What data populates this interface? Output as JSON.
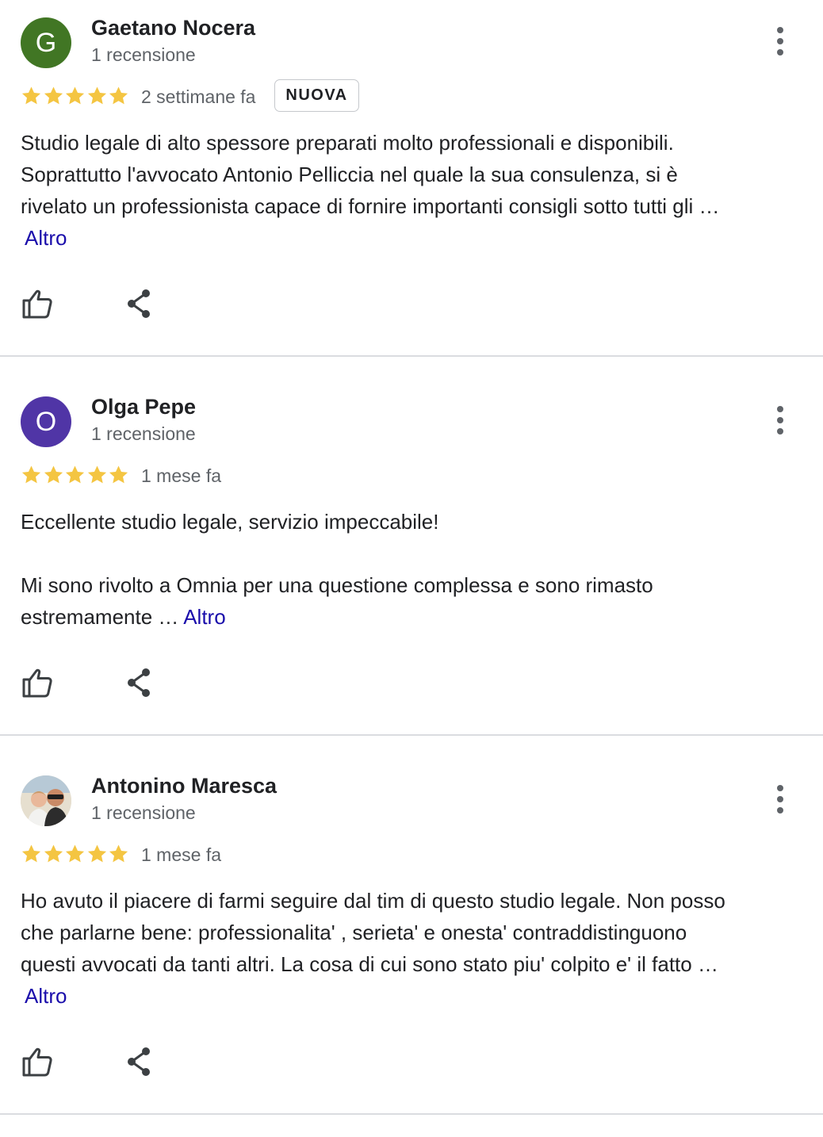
{
  "reviews": [
    {
      "avatar_letter": "G",
      "avatar_color": "#417624",
      "name": "Gaetano Nocera",
      "review_count": "1 recensione",
      "rating": 5,
      "date": "2 settimane fa",
      "badge": "NUOVA",
      "text_lines": [
        "Studio legale di alto spessore preparati molto professionali e disponibili.",
        "Soprattutto l'avvocato Antonio Pelliccia nel quale la sua consulenza, si è",
        "rivelato un professionista capace di fornire importanti consigli sotto tutti gli …"
      ],
      "more_label": "Altro",
      "icons": {
        "menu": "more-vert-icon",
        "like": "thumbs-up-icon",
        "share": "share-icon"
      }
    },
    {
      "avatar_letter": "O",
      "avatar_color": "#5035a6",
      "name": "Olga Pepe",
      "review_count": "1 recensione",
      "rating": 5,
      "date": "1 mese fa",
      "text_line_1": "Eccellente studio legale, servizio impeccabile!",
      "text_line_2": "Mi sono rivolto a Omnia per una questione complessa e sono rimasto",
      "text_line_3": "estremamente …",
      "more_label": "Altro",
      "icons": {
        "menu": "more-vert-icon",
        "like": "thumbs-up-icon",
        "share": "share-icon"
      }
    },
    {
      "avatar": "photo-avatar",
      "name": "Antonino Maresca",
      "review_count": "1 recensione",
      "rating": 5,
      "date": "1 mese fa",
      "text_lines": [
        "Ho avuto il piacere di farmi seguire dal tim di questo studio legale. Non posso",
        "che parlarne bene: professionalita' , serieta' e onesta' contraddistinguono",
        "questi avvocati da tanti altri. La cosa di cui sono stato piu' colpito e' il fatto …"
      ],
      "more_label": "Altro",
      "icons": {
        "menu": "more-vert-icon",
        "like": "thumbs-up-icon",
        "share": "share-icon"
      }
    }
  ],
  "colors": {
    "star": "#f4c542",
    "link": "#1a0dab",
    "secondary_text": "#5f6368",
    "divider": "#dadce0"
  }
}
